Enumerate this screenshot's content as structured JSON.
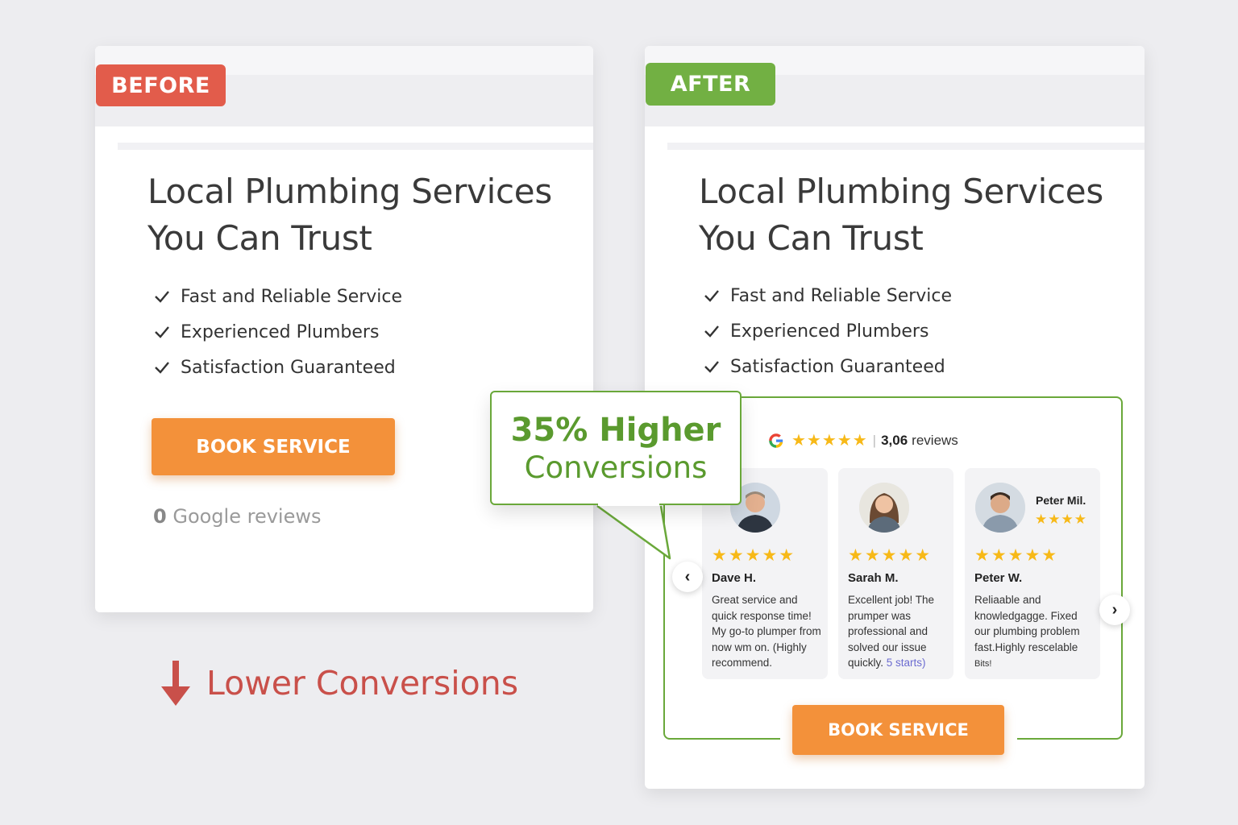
{
  "before": {
    "tag": "BEFORE",
    "tag_color": "#e25c4b",
    "headline_line1": "Local Plumbing Services",
    "headline_line2": "You Can Trust",
    "features": [
      "Fast and Reliable Service",
      "Experienced Plumbers",
      "Satisfaction Guaranteed"
    ],
    "button_label": "BOOK SERVICE",
    "reviews_count": "0",
    "reviews_label": "Google reviews"
  },
  "lower_conversions": "Lower Conversions",
  "after": {
    "tag": "AFTER",
    "tag_color": "#72b043",
    "headline_line1": "Local Plumbing Services",
    "headline_line2": "You Can Trust",
    "features": [
      "Fast and Reliable Service",
      "Experienced Plumbers",
      "Satisfaction Guaranteed"
    ],
    "google_rating_stars": "★★★★★",
    "google_reviews_number": "3,06",
    "google_reviews_label": "reviews",
    "reviews": [
      {
        "name": "Dave H.",
        "stars": "★★★★★",
        "text": "Great service and quick response time! My go-to plumper from now wm on. (Highly recommend."
      },
      {
        "name": "Sarah M.",
        "stars": "★★★★★",
        "text": "Excellent job! The prumper was professional and solved our issue quickly.",
        "highlight": "5 starts)"
      },
      {
        "name": "Peter W.",
        "stars": "★★★★★",
        "text": "Reliaable and knowledgagge. Fixed our plumbing problem fast.Highly rescelable",
        "extra": "Bits!",
        "badge_name": "Peter Mil.",
        "badge_stars": "★★★★"
      }
    ],
    "button_label": "BOOK SERVICE"
  },
  "callout": {
    "line1": "35% Higher",
    "line2": "Conversions"
  },
  "colors": {
    "accent_orange": "#f3913a",
    "accent_green": "#6aa83a",
    "lower_red": "#c9504a",
    "star_yellow": "#f7b918"
  }
}
